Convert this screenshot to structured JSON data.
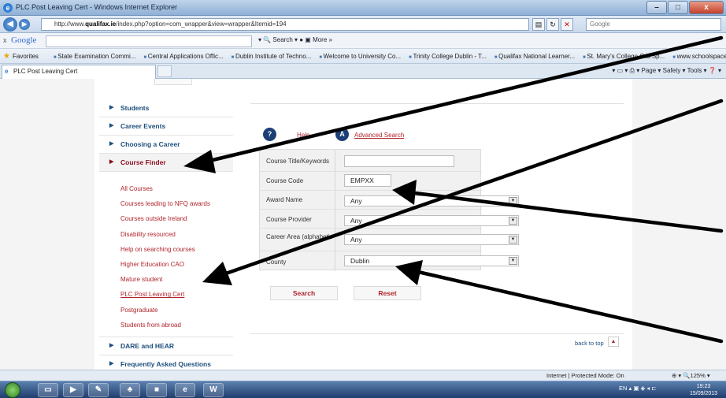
{
  "window": {
    "title": "PLC Post Leaving Cert - Windows Internet Explorer",
    "min": "–",
    "max": "□",
    "close": "x"
  },
  "addressbar": {
    "url_prefix": "http://www.",
    "url_domain": "qualifax.ie",
    "url_path": "/index.php?option=com_wrapper&view=wrapper&Itemid=194",
    "search_placeholder": "Google"
  },
  "googlebar": {
    "close": "x",
    "logo": "Google",
    "tools": "▾   🔍 Search ▾   ●  ▣   More »"
  },
  "favorites": {
    "label": "Favorites",
    "items": [
      "State Examination Commi...",
      "Central Applications Offic...",
      "Dublin Institute of Techno...",
      "Welcome to University Co...",
      "Trinity College Dublin - T...",
      "Qualifax National Learner...",
      "St. Mary's College C.S.Sp...",
      "www.schoolspace.i..."
    ]
  },
  "tabbar": {
    "tab_label": "PLC Post Leaving Cert",
    "commands": "▾  ▭ ▾  ⎙ ▾  Page ▾  Safety ▾  Tools ▾  ❓ ▾"
  },
  "sidebar": {
    "main_top": [
      "Students",
      "Career Events",
      "Choosing a Career"
    ],
    "active": "Course Finder",
    "sub": [
      "All Courses",
      "Courses leading to NFQ awards",
      "Courses outside Ireland",
      "Disability resourced",
      "Help on searching courses",
      "Higher Education CAO",
      "Mature student",
      "PLC Post Leaving Cert",
      "Postgraduate",
      "Students from abroad"
    ],
    "main_bottom": [
      "DARE and HEAR",
      "Frequently Asked Questions"
    ]
  },
  "content": {
    "help_icon": "?",
    "help_link": "Help",
    "advanced_icon": "A",
    "advanced_link": "Advanced Search",
    "form": {
      "title_label": "Course Title/Keywords",
      "title_value": "",
      "code_label": "Course Code",
      "code_value": "EMPXX",
      "award_label": "Award Name",
      "award_value": "Any",
      "provider_label": "Course Provider",
      "provider_value": "Any",
      "career_label": "Career Area (alphabetic",
      "career_value": "Any",
      "county_label": "County",
      "county_value": "Dublin"
    },
    "search_button": "Search",
    "reset_button": "Reset",
    "back_to_top": "back to top",
    "back_to_top_icon": "▲"
  },
  "statusbar": {
    "zone": "Internet | Protected Mode: On",
    "zoom": "⊕ ▾  🔍125% ▾"
  },
  "taskbar": {
    "tray": "EN  ▴  ▣ ◈ ◂ ⊏",
    "time": "19:23",
    "date": "15/09/2013"
  },
  "colors": {
    "sidebar_link": "#b0262d",
    "nav_blue": "#1d4f7c",
    "active_red": "#8b0d1f",
    "circle_blue": "#1d3f78"
  }
}
